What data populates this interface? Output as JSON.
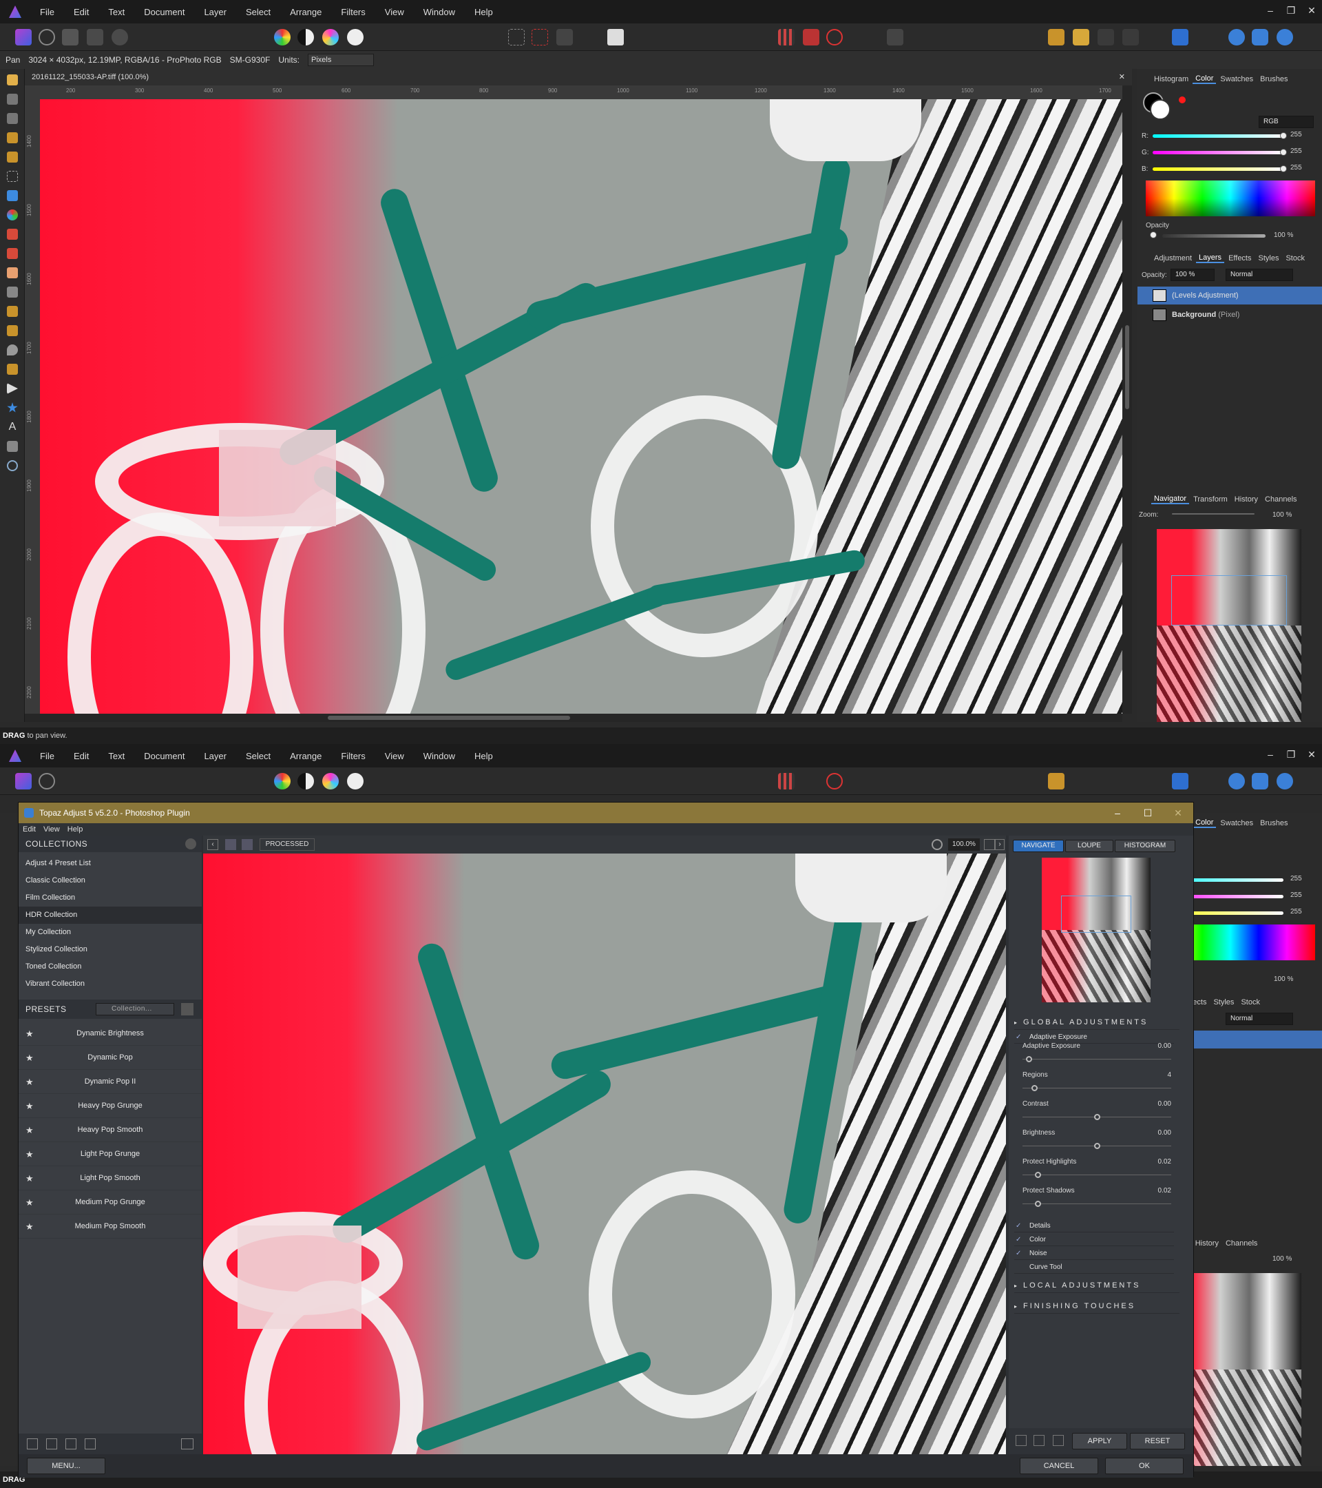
{
  "menu": [
    "File",
    "Edit",
    "Text",
    "Document",
    "Layer",
    "Select",
    "Arrange",
    "Filters",
    "View",
    "Window",
    "Help"
  ],
  "context": {
    "tool": "Pan",
    "info": "3024 × 4032px, 12.19MP, RGBA/16 - ProPhoto RGB",
    "camera": "SM-G930F",
    "units_label": "Units:",
    "units_value": "Pixels"
  },
  "document_tab": "20161122_155033-AP.tiff (100.0%)",
  "ruler_h": [
    "200",
    "300",
    "400",
    "500",
    "600",
    "700",
    "800",
    "900",
    "1000",
    "1100",
    "1200",
    "1300",
    "1400",
    "1500",
    "1600",
    "1700"
  ],
  "ruler_v": [
    "1400",
    "1500",
    "1600",
    "1700",
    "1800",
    "1900",
    "2000",
    "2100",
    "2200"
  ],
  "status": {
    "bold": "DRAG",
    "text": " to pan view."
  },
  "right_panel": {
    "tabs_top": [
      "Histogram",
      "Color",
      "Swatches",
      "Brushes"
    ],
    "color_mode": "RGB",
    "channels": [
      {
        "label": "R:",
        "value": "255"
      },
      {
        "label": "G:",
        "value": "255"
      },
      {
        "label": "B:",
        "value": "255"
      }
    ],
    "opacity_label": "Opacity",
    "opacity_value": "100 %",
    "tabs_mid": [
      "Adjustment",
      "Layers",
      "Effects",
      "Styles",
      "Stock"
    ],
    "layer_opacity_label": "Opacity:",
    "layer_opacity_value": "100 %",
    "blend_mode": "Normal",
    "layers": [
      {
        "name": "(Levels Adjustment)",
        "sub": ""
      },
      {
        "name": "Background",
        "sub": " (Pixel)"
      }
    ],
    "tabs_bottom": [
      "Navigator",
      "Transform",
      "History",
      "Channels"
    ],
    "zoom_label": "Zoom:",
    "zoom_value": "100 %"
  },
  "topaz": {
    "title": "Topaz Adjust 5 v5.2.0 - Photoshop Plugin",
    "menu": [
      "Edit",
      "View",
      "Help"
    ],
    "collections_header": "COLLECTIONS",
    "collections": [
      "Adjust 4 Preset List",
      "Classic Collection",
      "Film Collection",
      "HDR Collection",
      "My Collection",
      "Stylized Collection",
      "Toned Collection",
      "Vibrant Collection"
    ],
    "presets_header": "PRESETS",
    "collection_select": "Collection...",
    "presets": [
      "Dynamic Brightness",
      "Dynamic Pop",
      "Dynamic Pop II",
      "Heavy Pop Grunge",
      "Heavy Pop Smooth",
      "Light Pop Grunge",
      "Light Pop Smooth",
      "Medium Pop Grunge",
      "Medium Pop Smooth"
    ],
    "processed_label": "PROCESSED",
    "zoom": "100.0%",
    "right_tabs": [
      "NAVIGATE",
      "LOUPE",
      "HISTOGRAM"
    ],
    "global_header": "GLOBAL ADJUSTMENTS",
    "adaptive_header": "Adaptive Exposure",
    "adjustments": [
      {
        "name": "Adaptive Exposure",
        "value": "0.00",
        "pos": 0.04
      },
      {
        "name": "Regions",
        "value": "4",
        "pos": 0.08
      },
      {
        "name": "Contrast",
        "value": "0.00",
        "pos": 0.5
      },
      {
        "name": "Brightness",
        "value": "0.00",
        "pos": 0.5
      },
      {
        "name": "Protect Highlights",
        "value": "0.02",
        "pos": 0.1
      },
      {
        "name": "Protect Shadows",
        "value": "0.02",
        "pos": 0.1
      }
    ],
    "sub_sections": [
      "Details",
      "Color",
      "Noise",
      "Curve Tool"
    ],
    "local_header": "LOCAL ADJUSTMENTS",
    "finishing_header": "FINISHING TOUCHES",
    "apply": "APPLY",
    "reset": "RESET",
    "menu_button": "MENU...",
    "cancel": "CANCEL",
    "ok": "OK"
  },
  "colors": {
    "accent": "#4a8fe0",
    "topaz_title": "#8b773a",
    "selected_layer": "#3e6fb6",
    "red_swatch": "#ff1a1a"
  }
}
